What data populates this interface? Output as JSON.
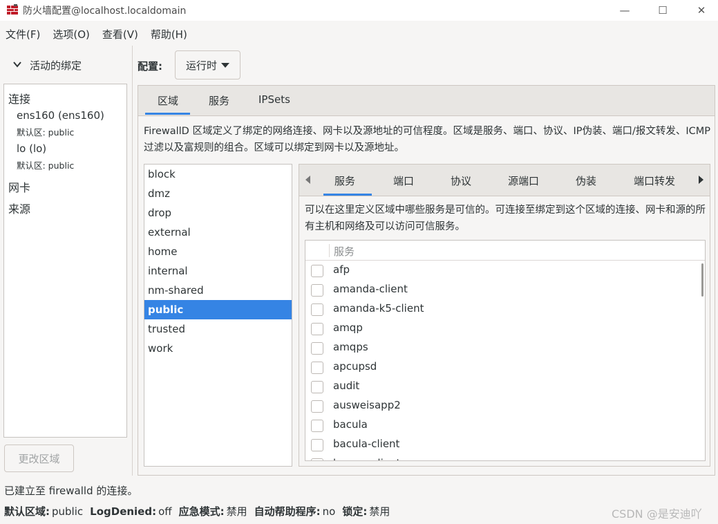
{
  "window": {
    "title": "防火墙配置@localhost.localdomain",
    "minimize": "—",
    "maximize": "☐",
    "close": "✕"
  },
  "menu": [
    "文件(F)",
    "选项(O)",
    "查看(V)",
    "帮助(H)"
  ],
  "left": {
    "header": "活动的绑定",
    "connections_label": "连接",
    "connections": [
      {
        "name": "ens160 (ens160)",
        "zone": "默认区: public"
      },
      {
        "name": "lo (lo)",
        "zone": "默认区: public"
      }
    ],
    "nic_label": "网卡",
    "source_label": "来源",
    "change_zone_button": "更改区域"
  },
  "config": {
    "label": "配置:",
    "value": "运行时"
  },
  "main_tabs": [
    "区域",
    "服务",
    "IPSets"
  ],
  "zone_description": "FirewallD 区域定义了绑定的网络连接、网卡以及源地址的可信程度。区域是服务、端口、协议、IP伪装、端口/报文转发、ICMP过滤以及富规则的组合。区域可以绑定到网卡以及源地址。",
  "zones": [
    "block",
    "dmz",
    "drop",
    "external",
    "home",
    "internal",
    "nm-shared",
    "public",
    "trusted",
    "work"
  ],
  "selected_zone": "public",
  "sub_tabs": [
    "服务",
    "端口",
    "协议",
    "源端口",
    "伪装",
    "端口转发"
  ],
  "services_description": "可以在这里定义区域中哪些服务是可信的。可连接至绑定到这个区域的连接、网卡和源的所有主机和网络及可以访问可信服务。",
  "services_header": "服务",
  "services": [
    "afp",
    "amanda-client",
    "amanda-k5-client",
    "amqp",
    "amqps",
    "apcupsd",
    "audit",
    "ausweisapp2",
    "bacula",
    "bacula-client",
    "bareos-client"
  ],
  "status": {
    "connection": "已建立至 firewalld 的连接。",
    "default_zone_label": "默认区域:",
    "default_zone": "public",
    "logdenied_label": "LogDenied:",
    "logdenied": "off",
    "panic_label": "应急模式:",
    "panic": "禁用",
    "helper_label": "自动帮助程序:",
    "helper": "no",
    "lockdown_label": "锁定:",
    "lockdown": "禁用"
  },
  "watermark": "CSDN @是安迪吖",
  "colors": {
    "accent": "#3584e4",
    "icon_red": "#c01c28"
  }
}
